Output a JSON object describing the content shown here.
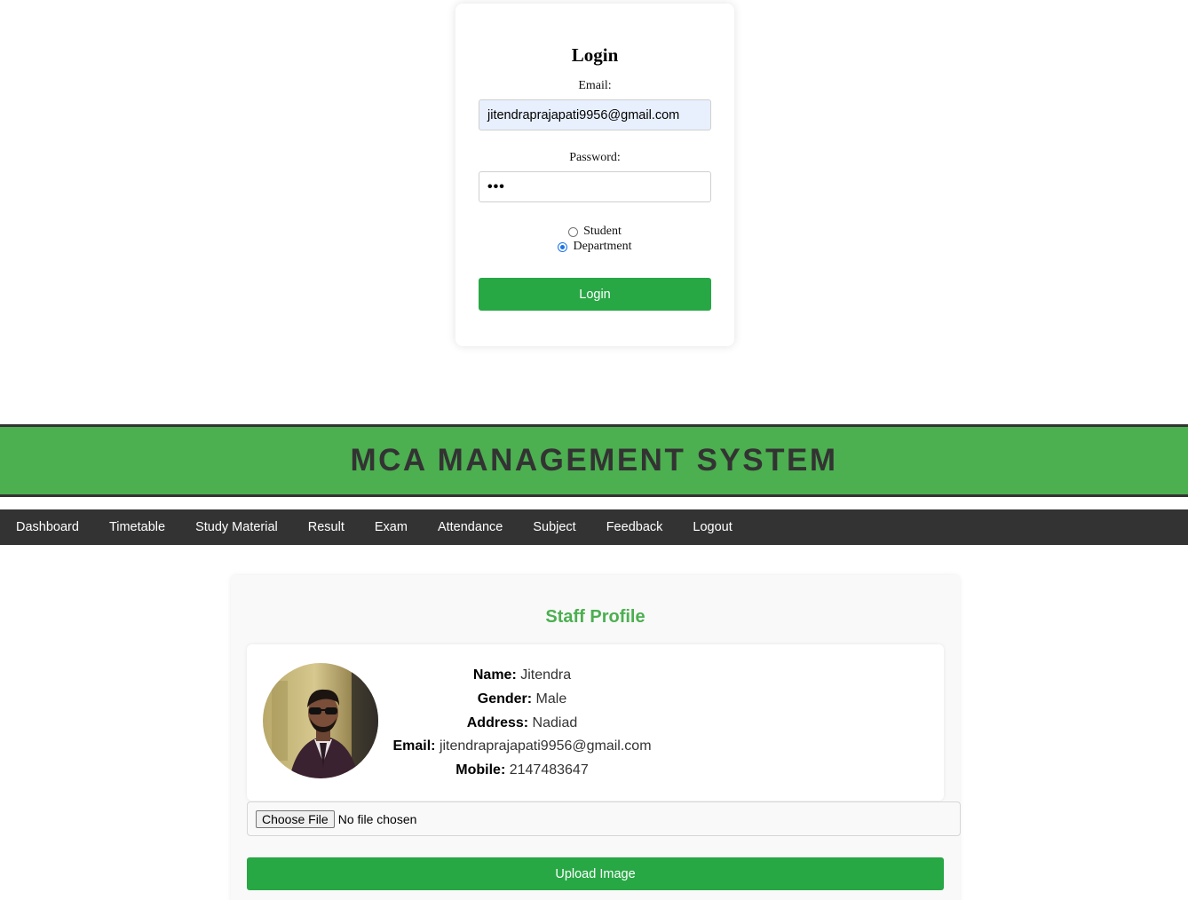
{
  "login": {
    "title": "Login",
    "email_label": "Email:",
    "email_value": "jitendraprajapati9956@gmail.com",
    "password_label": "Password:",
    "password_mask": "•••",
    "roles": [
      {
        "label": "Student",
        "checked": false
      },
      {
        "label": "Department",
        "checked": true
      }
    ],
    "submit_label": "Login"
  },
  "header": {
    "title": "MCA MANAGEMENT SYSTEM"
  },
  "nav": {
    "items": [
      "Dashboard",
      "Timetable",
      "Study Material",
      "Result",
      "Exam",
      "Attendance",
      "Subject",
      "Feedback",
      "Logout"
    ]
  },
  "profile": {
    "title": "Staff Profile",
    "fields": [
      {
        "key": "Name:",
        "value": "Jitendra"
      },
      {
        "key": "Gender:",
        "value": "Male"
      },
      {
        "key": "Address:",
        "value": "Nadiad"
      },
      {
        "key": "Email:",
        "value": "jitendraprajapati9956@gmail.com"
      },
      {
        "key": "Mobile:",
        "value": "2147483647"
      }
    ],
    "choose_file_label": "Choose File",
    "no_file_text": "No file chosen",
    "upload_label": "Upload Image"
  },
  "colors": {
    "brand_green": "#4caf50",
    "button_green": "#28a745",
    "nav_bg": "#333333"
  }
}
